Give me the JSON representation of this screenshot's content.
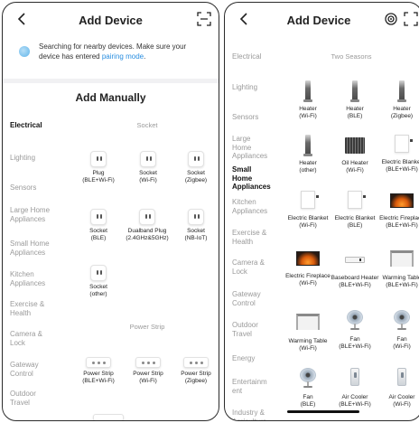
{
  "left_screen": {
    "title": "Add Device",
    "search_message": "Searching for nearby devices. Make sure your device has entered",
    "search_link": "pairing mode",
    "search_period": ".",
    "manual_title": "Add Manually",
    "sidebar": [
      {
        "label": "Electrical",
        "active": true
      },
      {
        "label": "Lighting",
        "active": false
      },
      {
        "label": "Sensors",
        "active": false
      },
      {
        "label": "Large Home Appliances",
        "active": false
      },
      {
        "label": "Small Home Appliances",
        "active": false
      },
      {
        "label": "Kitchen Appliances",
        "active": false
      },
      {
        "label": "Exercise & Health",
        "active": false
      },
      {
        "label": "Camera & Lock",
        "active": false
      },
      {
        "label": "Gateway Control",
        "active": false
      },
      {
        "label": "Outdoor Travel",
        "active": false
      }
    ],
    "section_socket": "Socket",
    "section_power_strip": "Power Strip",
    "sockets": [
      {
        "name": "Plug",
        "sub": "(BLE+Wi-Fi)"
      },
      {
        "name": "Socket",
        "sub": "(Wi-Fi)"
      },
      {
        "name": "Socket",
        "sub": "(Zigbee)"
      },
      {
        "name": "Socket",
        "sub": "(BLE)"
      },
      {
        "name": "Dualband Plug",
        "sub": "(2.4GHz&5GHz)"
      },
      {
        "name": "Socket",
        "sub": "(NB-IoT)"
      },
      {
        "name": "Socket",
        "sub": "(other)"
      }
    ],
    "power_strips": [
      {
        "name": "Power Strip",
        "sub": "(BLE+Wi-Fi)"
      },
      {
        "name": "Power Strip",
        "sub": "(Wi-Fi)"
      },
      {
        "name": "Power Strip",
        "sub": "(Zigbee)"
      }
    ]
  },
  "right_screen": {
    "title": "Add Device",
    "sidebar": [
      {
        "label": "Electrical",
        "active": false
      },
      {
        "label": "Lighting",
        "active": false
      },
      {
        "label": "Sensors",
        "active": false
      },
      {
        "label": "Large Home Appliances",
        "active": false
      },
      {
        "label": "Small Home Appliances",
        "active": true
      },
      {
        "label": "Kitchen Appliances",
        "active": false
      },
      {
        "label": "Exercise & Health",
        "active": false
      },
      {
        "label": "Camera & Lock",
        "active": false
      },
      {
        "label": "Gateway Control",
        "active": false
      },
      {
        "label": "Outdoor Travel",
        "active": false
      },
      {
        "label": "Energy",
        "active": false
      },
      {
        "label": "Entertainm ent",
        "active": false
      },
      {
        "label": "Industry & Agriculture",
        "active": false
      }
    ],
    "section_two_seasons": "Two Seasons",
    "devices": [
      {
        "name": "Heater",
        "sub": "(Wi-Fi)",
        "icon": "tower-heater-icon"
      },
      {
        "name": "Heater",
        "sub": "(BLE)",
        "icon": "tower-heater-icon"
      },
      {
        "name": "Heater",
        "sub": "(Zigbee)",
        "icon": "tower-heater-icon"
      },
      {
        "name": "Heater",
        "sub": "(other)",
        "icon": "tower-heater-icon"
      },
      {
        "name": "Oil Heater",
        "sub": "(Wi-Fi)",
        "icon": "oil-heater-icon"
      },
      {
        "name": "Electric Blanket",
        "sub": "(BLE+Wi-Fi)",
        "icon": "electric-blanket-icon"
      },
      {
        "name": "Electric Blanket",
        "sub": "(Wi-Fi)",
        "icon": "electric-blanket-icon"
      },
      {
        "name": "Electric Blanket",
        "sub": "(BLE)",
        "icon": "electric-blanket-icon"
      },
      {
        "name": "Electric Fireplace",
        "sub": "(BLE+Wi-Fi)",
        "icon": "fireplace-icon"
      },
      {
        "name": "Electric Fireplace",
        "sub": "(Wi-Fi)",
        "icon": "fireplace-icon"
      },
      {
        "name": "Baseboard Heater",
        "sub": "(BLE+Wi-Fi)",
        "icon": "baseboard-heater-icon"
      },
      {
        "name": "Warming Table",
        "sub": "(BLE+Wi-Fi)",
        "icon": "warming-table-icon"
      },
      {
        "name": "Warming Table",
        "sub": "(Wi-Fi)",
        "icon": "warming-table-icon"
      },
      {
        "name": "Fan",
        "sub": "(BLE+Wi-Fi)",
        "icon": "fan-icon"
      },
      {
        "name": "Fan",
        "sub": "(Wi-Fi)",
        "icon": "fan-icon"
      },
      {
        "name": "Fan",
        "sub": "(BLE)",
        "icon": "fan-icon"
      },
      {
        "name": "Air Cooler",
        "sub": "(BLE+Wi-Fi)",
        "icon": "air-cooler-icon"
      },
      {
        "name": "Air Cooler",
        "sub": "(Wi-Fi)",
        "icon": "air-cooler-icon"
      }
    ]
  }
}
